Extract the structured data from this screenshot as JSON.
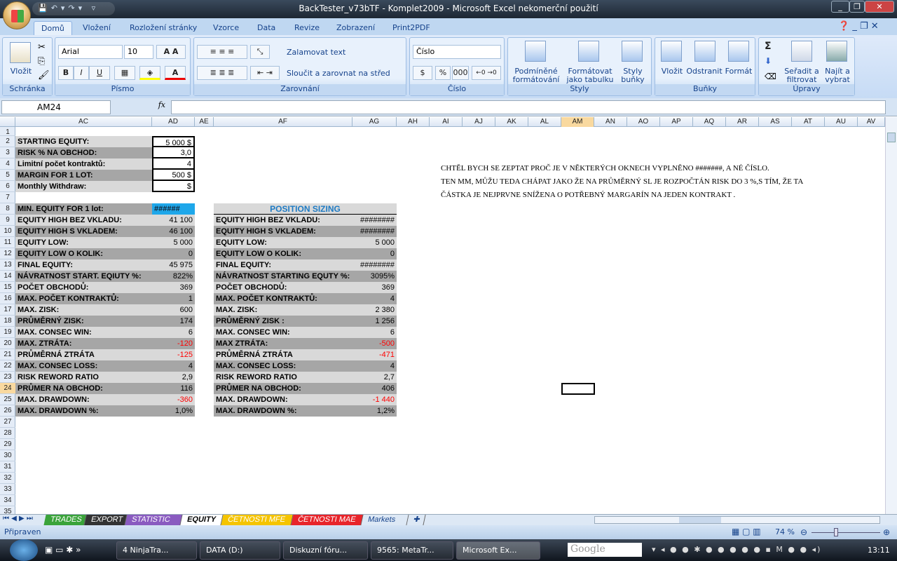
{
  "window": {
    "title": "BackTester_v73bTF - Komplet2009 - Microsoft Excel nekomerční použití"
  },
  "tabs": [
    "Domů",
    "Vložení",
    "Rozložení stránky",
    "Vzorce",
    "Data",
    "Revize",
    "Zobrazení",
    "Print2PDF"
  ],
  "ribbon": {
    "clipboard": {
      "paste": "Vložit",
      "label": "Schránka"
    },
    "font": {
      "name": "Arial",
      "size": "10",
      "bold": "B",
      "italic": "I",
      "underline": "U",
      "label": "Písmo"
    },
    "alignment": {
      "wrap": "Zalamovat text",
      "merge": "Sloučit a zarovnat na střed",
      "label": "Zarovnání"
    },
    "number": {
      "format": "Číslo",
      "percent": "%",
      "thousands": "000",
      "label": "Číslo"
    },
    "styles": {
      "conditional": [
        "Podmíněné",
        "formátování"
      ],
      "as_table": [
        "Formátovat",
        "jako tabulku"
      ],
      "cell_styles": [
        "Styly",
        "buňky"
      ],
      "label": "Styly"
    },
    "cells": {
      "insert": "Vložit",
      "delete": "Odstranit",
      "format": "Formát",
      "label": "Buňky"
    },
    "editing": {
      "sort": [
        "Seřadit a",
        "filtrovat"
      ],
      "find": [
        "Najít a",
        "vybrat"
      ],
      "sum": "Σ",
      "label": "Úpravy"
    }
  },
  "formula_bar": {
    "name_box": "AM24",
    "fx": "fx",
    "value": ""
  },
  "columns": [
    "AC",
    "AD",
    "AE",
    "AF",
    "AG",
    "AH",
    "AI",
    "AJ",
    "AK",
    "AL",
    "AM",
    "AN",
    "AO",
    "AP",
    "AQ",
    "AR",
    "AS",
    "AT",
    "AU",
    "AV"
  ],
  "selected_column": "AM",
  "selected_row": 24,
  "rows": 37,
  "inputs": [
    {
      "label": "STARTING EQUITY:",
      "value": "5 000 $"
    },
    {
      "label": "RISK % NA OBCHOD:",
      "value": "3,0"
    },
    {
      "label": "Limitní počet kontraktů:",
      "value": "4"
    },
    {
      "label": "MARGIN FOR 1 LOT:",
      "value": "500 $"
    },
    {
      "label": "Monthly Withdraw:",
      "value": "$"
    }
  ],
  "min_equity": {
    "label": "MIN. EQUITY FOR 1 lot:",
    "value": "######"
  },
  "stats": [
    {
      "label": "EQUITY HIGH BEZ VKLADU:",
      "value": "41 100"
    },
    {
      "label": "EQUITY HIGH S VKLADEM:",
      "value": "46 100"
    },
    {
      "label": "EQUITY LOW:",
      "value": "5 000"
    },
    {
      "label": "EQUITY LOW O KOLIK:",
      "value": "0"
    },
    {
      "label": "FINAL EQUITY:",
      "value": "45 975"
    },
    {
      "label": "NÁVRATNOST START. EQIUTY %:",
      "value": "822%"
    },
    {
      "label": "POČET OBCHODŮ:",
      "value": "369"
    },
    {
      "label": "MAX. POČET KONTRAKTŮ:",
      "value": "1"
    },
    {
      "label": "MAX. ZISK:",
      "value": "600"
    },
    {
      "label": "PRŮMĚRNÝ ZISK:",
      "value": "174"
    },
    {
      "label": "MAX. CONSEC WIN:",
      "value": "6"
    },
    {
      "label": "MAX. ZTRÁTA:",
      "value": "-120",
      "negative": true
    },
    {
      "label": "PRŮMĚRNÁ ZTRÁTA",
      "value": "-125",
      "negative": true
    },
    {
      "label": "MAX. CONSEC LOSS:",
      "value": "4"
    },
    {
      "label": "RISK REWORD RATIO",
      "value": "2,9"
    },
    {
      "label": "PRŮMER NA OBCHOD:",
      "value": "116"
    },
    {
      "label": "MAX. DRAWDOWN:",
      "value": "-360",
      "negative": true
    },
    {
      "label": "MAX. DRAWDOWN %:",
      "value": "1,0%"
    }
  ],
  "position_sizing": {
    "title": "POSITION SIZING",
    "title_color": "#1f7bc4",
    "rows": [
      {
        "label": "EQUITY HIGH BEZ VKLADU:",
        "value": "########"
      },
      {
        "label": "EQUITY HIGH S VKLADEM:",
        "value": "########"
      },
      {
        "label": "EQUITY LOW:",
        "value": "5 000"
      },
      {
        "label": "EQUITY LOW O KOLIK:",
        "value": "0"
      },
      {
        "label": "FINAL EQUITY:",
        "value": "########"
      },
      {
        "label": "NÁVRATNOST STARTING EQUTY %:",
        "value": "3095%"
      },
      {
        "label": "POČET OBCHODŮ:",
        "value": "369"
      },
      {
        "label": "MAX. POČET KONTRAKTŮ:",
        "value": "4"
      },
      {
        "label": "MAX. ZISK:",
        "value": "2 380"
      },
      {
        "label": "PRŮMĚRNÝ ZISK :",
        "value": "1 256"
      },
      {
        "label": "MAX. CONSEC WIN:",
        "value": "6"
      },
      {
        "label": "MAX ZTRÁTA:",
        "value": "-500",
        "negative": true
      },
      {
        "label": "PRŮMĚRNÁ ZTRÁTA",
        "value": "-471",
        "negative": true
      },
      {
        "label": "MAX. CONSEC LOSS:",
        "value": "4"
      },
      {
        "label": "RISK REWORD RATIO",
        "value": "2,7"
      },
      {
        "label": "PRŮMER NA OBCHOD:",
        "value": "406"
      },
      {
        "label": "MAX. DRAWDOWN:",
        "value": "-1 440",
        "negative": true
      },
      {
        "label": "MAX. DRAWDOWN %:",
        "value": "1,2%"
      }
    ]
  },
  "note": [
    "CHTĚL BYCH SE ZEPTAT PROČ JE V NĚKTERÝCH OKNECH VYPLNĚNO #######, A NÉ ČÍSLO.",
    "TEN MM, MŮŽU TEDA CHÁPAT JAKO ŽE NA PRŮMĚRNÝ SL JE ROZPOČTÁN RISK DO 3 %,S TÍM, ŽE TA",
    "ČÁSTKA JE NEJPRVNE SNÍŽENA O POTŘEBNÝ MARGARÍN NA JEDEN KONTRAKT ."
  ],
  "sheets": [
    {
      "name": "TRADES",
      "color": "#3aa33a"
    },
    {
      "name": "EXPORT",
      "color": "#333333"
    },
    {
      "name": "STATISTIC",
      "color": "#8a5bc0"
    },
    {
      "name": "EQUITY",
      "color": "#ffffff",
      "active": true
    },
    {
      "name": "ČETNOSTI MFE",
      "color": "#f5c400"
    },
    {
      "name": "ČETNOSTI MAE",
      "color": "#e8242a"
    },
    {
      "name": "Markets",
      "color": "#dde8f5"
    }
  ],
  "status": {
    "text": "Připraven",
    "zoom": "74 %"
  },
  "taskbar": {
    "items": [
      "4 NinjaTra...",
      "DATA (D:)",
      "Diskuzní fóru...",
      "9565: MetaTr...",
      "Microsoft Ex..."
    ],
    "search": "Google",
    "clock": "13:11"
  }
}
